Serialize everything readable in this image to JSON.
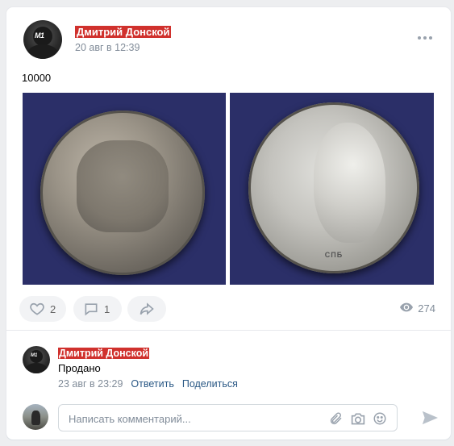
{
  "post": {
    "author": "Дмитрий Донской",
    "date": "20 авг в 12:39",
    "avatar_logo": "M1",
    "text": "10000"
  },
  "photos": [
    {
      "legend": ""
    },
    {
      "legend": "СПБ"
    }
  ],
  "actions": {
    "likes": "2",
    "comments": "1",
    "views": "274"
  },
  "comment": {
    "author": "Дмитрий Донской",
    "text": "Продано",
    "date": "23 авг в 23:29",
    "reply_label": "Ответить",
    "share_label": "Поделиться",
    "avatar_logo": "M1"
  },
  "reply": {
    "placeholder": "Написать комментарий..."
  },
  "icons": {
    "more": "more-dots-icon",
    "like": "heart-icon",
    "comment": "comment-icon",
    "share": "share-arrow-icon",
    "views": "eye-icon",
    "attach": "paperclip-icon",
    "camera": "camera-icon",
    "emoji": "smile-icon",
    "send": "send-icon"
  },
  "colors": {
    "background": "#edeef0",
    "card": "#ffffff",
    "author_highlight": "#d0312d",
    "link": "#2a5885",
    "secondary_text": "#818c99",
    "icon": "#99a2ad"
  }
}
